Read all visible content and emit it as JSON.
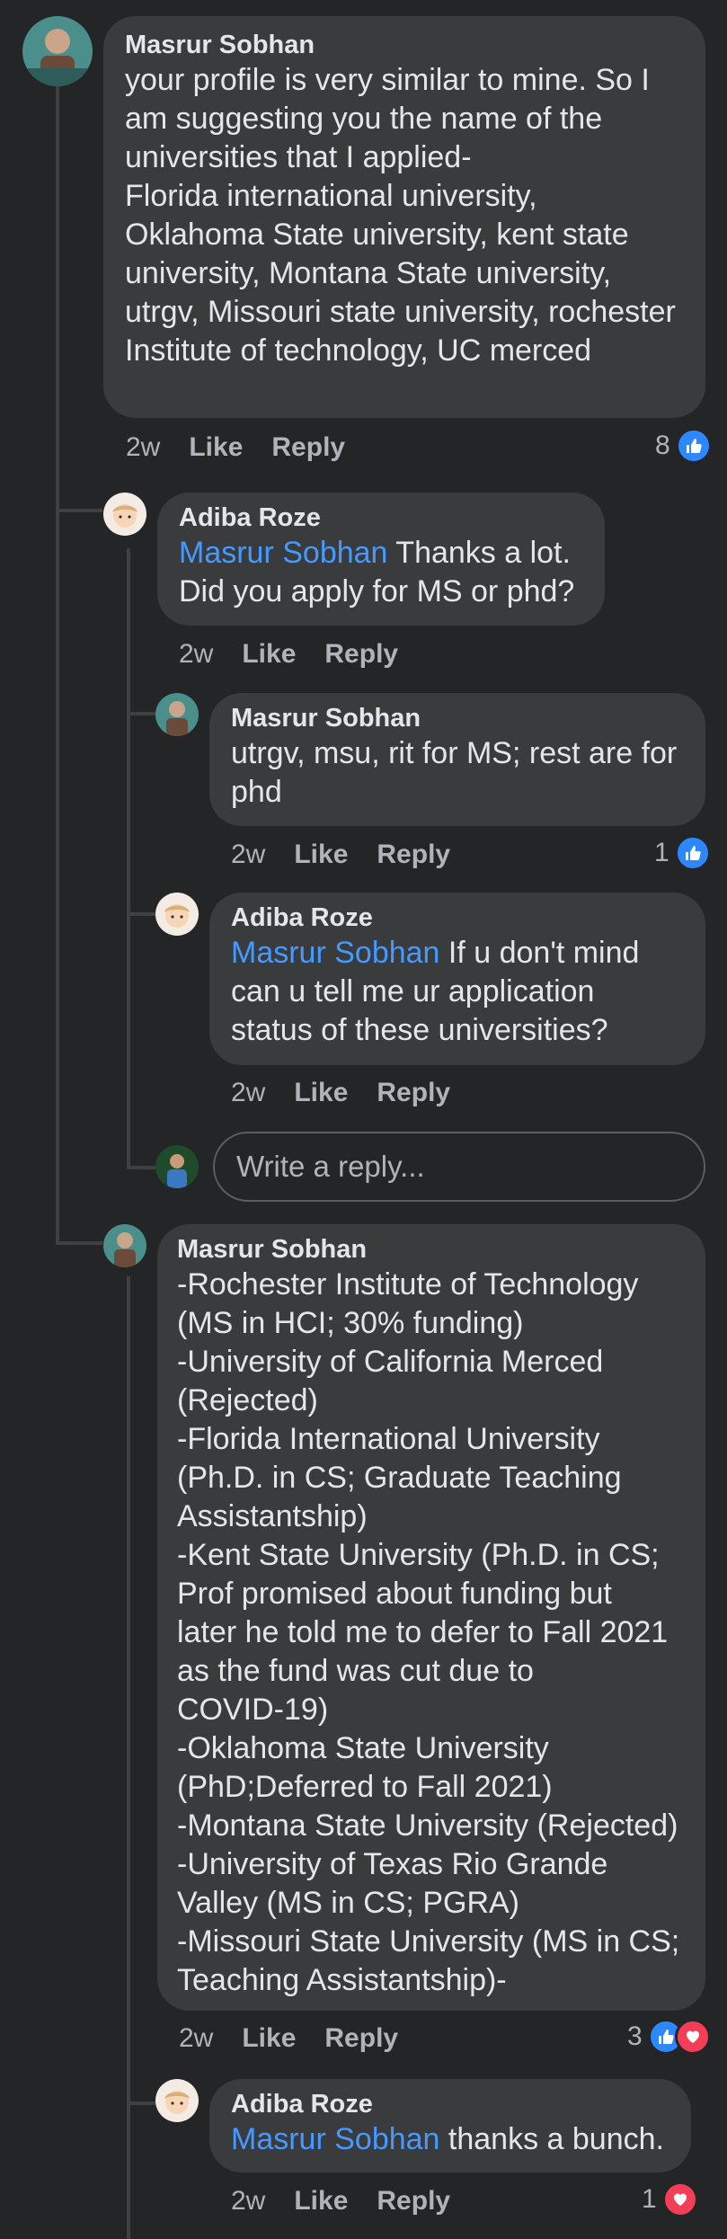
{
  "comments": {
    "c1": {
      "author": "Masrur Sobhan",
      "text": "your profile is very similar to mine. So I\nam  suggesting you the name of the\nuniversities that I applied-\nFlorida international university,\nOklahoma State university, kent state\nuniversity,  Montana State university,\nutrgv, Missouri state university, rochester\nInstitute of technology,  UC merced",
      "time": "2w",
      "like": "Like",
      "reply": "Reply",
      "reactions": "8"
    },
    "r1": {
      "author": "Adiba Roze",
      "mention": "Masrur Sobhan",
      "text": " Thanks a lot.\nDid you apply for MS or phd?",
      "time": "2w",
      "like": "Like",
      "reply": "Reply"
    },
    "r2": {
      "author": "Masrur Sobhan",
      "text": "utrgv, msu, rit for MS; rest are for\nphd",
      "time": "2w",
      "like": "Like",
      "reply": "Reply",
      "reactions": "1"
    },
    "r3": {
      "author": "Adiba Roze",
      "mention": "Masrur Sobhan",
      "text": " If u don't mind\ncan u tell me ur application\nstatus of these universities?",
      "time": "2w",
      "like": "Like",
      "reply": "Reply"
    },
    "reply_box": {
      "placeholder": "Write a reply..."
    },
    "r4": {
      "author": "Masrur Sobhan",
      "text": "-Rochester Institute of Technology\n(MS in HCI; 30% funding)\n-University of California Merced\n(Rejected)\n-Florida International University\n(Ph.D. in CS; Graduate Teaching\nAssistantship)\n-Kent State University (Ph.D. in CS;\nProf promised about funding but\nlater he told me to defer to Fall 2021\nas the fund was cut due to\nCOVID-19)\n-Oklahoma State University\n(PhD;Deferred to Fall 2021)\n-Montana State University (Rejected)\n-University of Texas Rio Grande\nValley (MS in CS; PGRA)\n-Missouri State University (MS in CS;\nTeaching Assistantship)-",
      "time": "2w",
      "like": "Like",
      "reply": "Reply",
      "reactions": "3"
    },
    "r5": {
      "author": "Adiba Roze",
      "mention": "Masrur Sobhan",
      "text": " thanks a bunch.",
      "time": "2w",
      "like": "Like",
      "reply": "Reply",
      "reactions": "1"
    }
  },
  "icons": {
    "like": "thumbs-up-icon",
    "love": "heart-icon"
  },
  "colors": {
    "background": "#242526",
    "bubble": "#3a3b3c",
    "mention": "#4599ff",
    "like": "#2d88ff",
    "love": "#f33e58",
    "meta": "#b0b3b8"
  }
}
